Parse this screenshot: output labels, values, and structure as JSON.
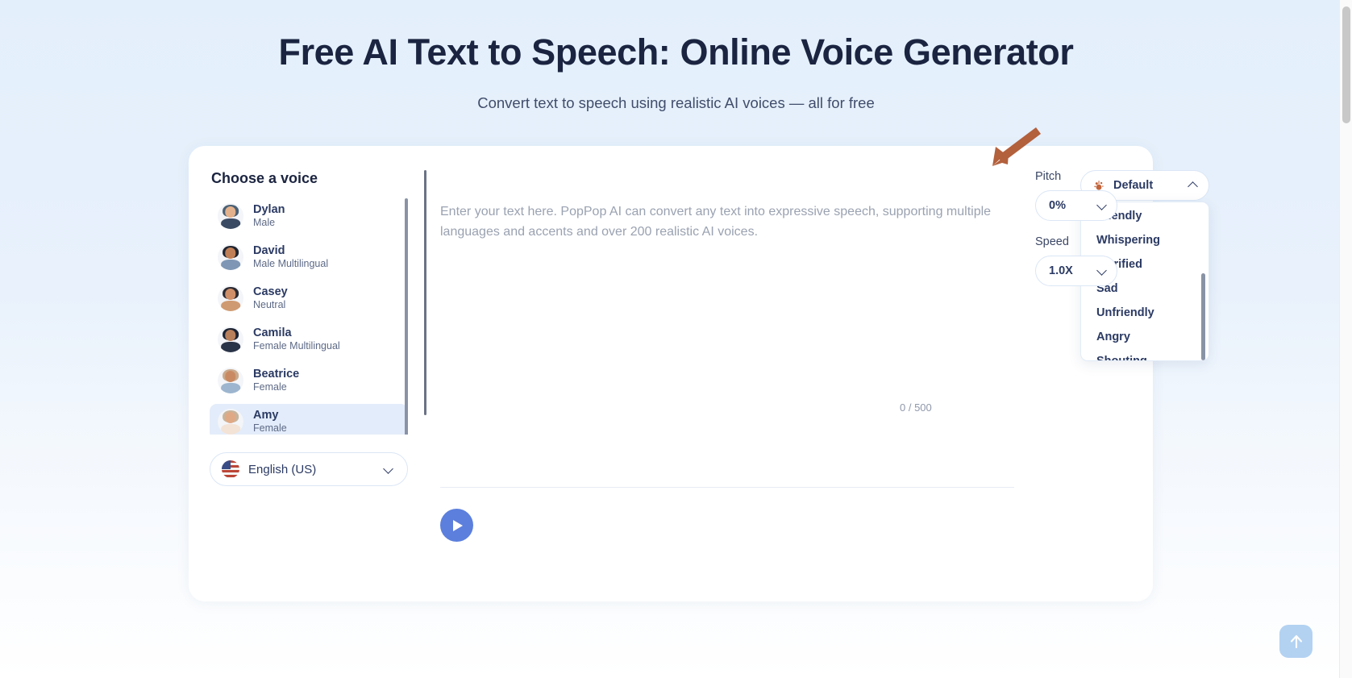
{
  "hero": {
    "title": "Free AI Text to Speech: Online Voice Generator",
    "subtitle": "Convert text to speech using realistic AI voices — all for free"
  },
  "voice_panel": {
    "heading": "Choose a voice",
    "voices": [
      {
        "name": "Amy",
        "role": "Female",
        "selected": true,
        "skin": "#e0a986",
        "hair": "#c8b49a",
        "cloth": "#f3e3d6"
      },
      {
        "name": "Beatrice",
        "role": "Female",
        "selected": false,
        "skin": "#c98a63",
        "hair": "#caa98c",
        "cloth": "#9db5cf"
      },
      {
        "name": "Camila",
        "role": "Female Multilingual",
        "selected": false,
        "skin": "#b9805c",
        "hair": "#1b2333",
        "cloth": "#2a3448"
      },
      {
        "name": "Casey",
        "role": "Neutral",
        "selected": false,
        "skin": "#d08f68",
        "hair": "#2b2a33",
        "cloth": "#cf9a72"
      },
      {
        "name": "David",
        "role": "Male Multilingual",
        "selected": false,
        "skin": "#c07f56",
        "hair": "#1f2430",
        "cloth": "#7f97b5"
      },
      {
        "name": "Dylan",
        "role": "Male",
        "selected": false,
        "skin": "#e3b18c",
        "hair": "#4a6075",
        "cloth": "#3b4a63"
      }
    ],
    "language": {
      "label": "English (US)",
      "flag_icon": "us-flag-icon",
      "chevron_icon": "chevron-down-icon"
    }
  },
  "editor": {
    "placeholder": "Enter your text here. PopPop AI can convert any text into expressive speech, supporting multiple languages and accents and over 200 realistic AI voices.",
    "char_count": "0 / 500",
    "play_icon": "play-icon"
  },
  "style_dropdown": {
    "selected": "Default",
    "icon": "emotion-sparkle-icon",
    "chevron_icon": "chevron-up-icon",
    "expanded": true,
    "options": [
      "Friendly",
      "Whispering",
      "Terrified",
      "Sad",
      "Unfriendly",
      "Angry",
      "Shouting"
    ]
  },
  "controls": {
    "pitch_label": "Pitch",
    "pitch_value": "0%",
    "speed_label": "Speed",
    "speed_value": "1.0X",
    "chevron_icon": "chevron-down-icon"
  },
  "annotation": {
    "arrow_icon": "annotation-arrow-icon",
    "arrow_color": "#b3603c"
  },
  "scroll_top": {
    "icon": "arrow-up-icon"
  },
  "colors": {
    "accent": "#5c7fdd",
    "title": "#1b2440",
    "selected_row": "#e3ecfa",
    "page_bg_top": "#e3effb"
  }
}
